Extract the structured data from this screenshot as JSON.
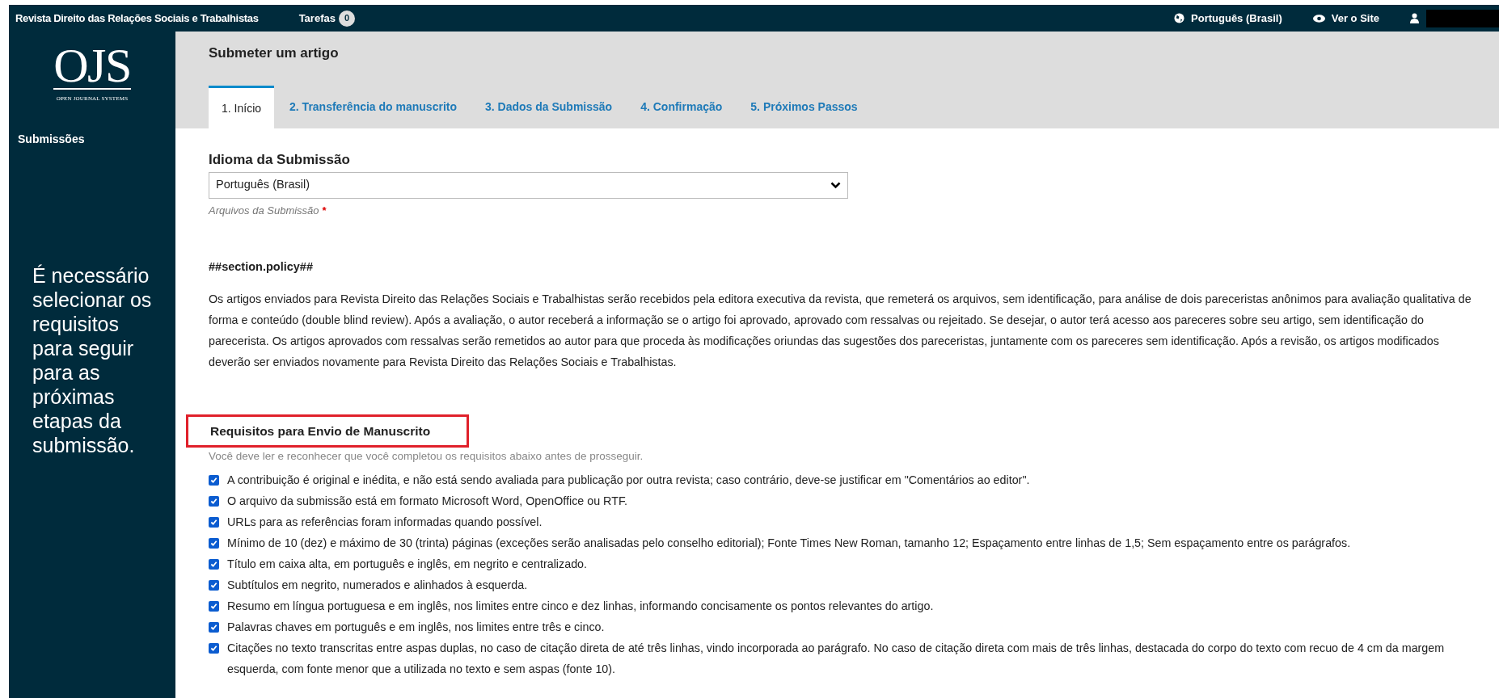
{
  "top_bar": {
    "journal_title": "Revista Direito das Relações Sociais e Trabalhistas",
    "tasks_label": "Tarefas",
    "tasks_count": "0",
    "language": "Português (Brasil)",
    "view_site": "Ver o Site"
  },
  "sidebar": {
    "logo_text": "OJS",
    "logo_subtitle": "OPEN JOURNAL SYSTEMS",
    "items": [
      {
        "label": "Submissões",
        "selected": false
      }
    ],
    "annotation": "É necessário selecionar os requisitos para seguir para as próximas etapas da submissão."
  },
  "page_title": "Submeter um artigo",
  "tabs": [
    {
      "label": "1. Início",
      "selected": true
    },
    {
      "label": "2. Transferência do manuscrito",
      "selected": false
    },
    {
      "label": "3. Dados da Submissão",
      "selected": false
    },
    {
      "label": "4. Confirmação",
      "selected": false
    },
    {
      "label": "5. Próximos Passos",
      "selected": false
    }
  ],
  "language_field": {
    "label": "Idioma da Submissão",
    "value": "Português (Brasil)",
    "hint": "Arquivos da Submissão",
    "required_mark": "*"
  },
  "policy": {
    "heading": "##section.policy##",
    "text": "Os artigos enviados para Revista Direito das Relações Sociais e Trabalhistas serão recebidos pela editora executiva da revista, que remeterá os arquivos, sem identificação, para análise de dois pareceristas anônimos para avaliação qualitativa de forma e conteúdo (double blind review). Após a avaliação, o autor receberá a informação se o artigo foi aprovado, aprovado com ressalvas ou rejeitado.  Se desejar, o autor terá acesso aos pareceres sobre seu artigo, sem identificação do parecerista. Os artigos aprovados com ressalvas serão remetidos ao autor para que proceda às modificações oriundas das sugestões dos pareceristas, juntamente com os pareceres sem identificação. Após a revisão, os artigos modificados  deverão ser enviados novamente para Revista Direito das Relações Sociais e Trabalhistas."
  },
  "requirements": {
    "heading": "Requisitos para Envio de Manuscrito",
    "highlighted": true,
    "instructions": "Você deve ler e reconhecer que você completou os requisitos abaixo antes de prosseguir.",
    "items": [
      {
        "text": "A contribuição é original e inédita, e não está sendo avaliada para publicação por outra revista; caso contrário, deve-se justificar em \"Comentários ao editor\".",
        "checked": true
      },
      {
        "text": "O arquivo da submissão está em formato Microsoft Word, OpenOffice ou RTF.",
        "checked": true
      },
      {
        "text": "URLs para as referências foram informadas quando possível.",
        "checked": true
      },
      {
        "text": "Mínimo de 10 (dez) e máximo de 30 (trinta) páginas (exceções serão analisadas pelo conselho editorial); Fonte Times New Roman, tamanho 12; Espaçamento entre linhas de 1,5; Sem espaçamento entre os parágrafos.",
        "checked": true
      },
      {
        "text": "Título em caixa alta, em português e inglês, em negrito e centralizado.",
        "checked": true
      },
      {
        "text": "Subtítulos em negrito, numerados e alinhados à esquerda.",
        "checked": true
      },
      {
        "text": "Resumo em língua portuguesa e em inglês, nos limites entre cinco e dez linhas, informando concisamente os pontos relevantes do artigo.",
        "checked": true
      },
      {
        "text": "Palavras chaves em português e em inglês, nos limites entre três e cinco.",
        "checked": true
      },
      {
        "text": "Citações no texto transcritas entre aspas duplas, no caso de citação direta de até três linhas, vindo incorporada ao parágrafo. No caso de citação direta com mais de três linhas, destacada do corpo do texto com recuo de 4 cm da margem esquerda, com fonte menor que a utilizada no texto e sem aspas (fonte 10).",
        "checked": true
      }
    ]
  }
}
